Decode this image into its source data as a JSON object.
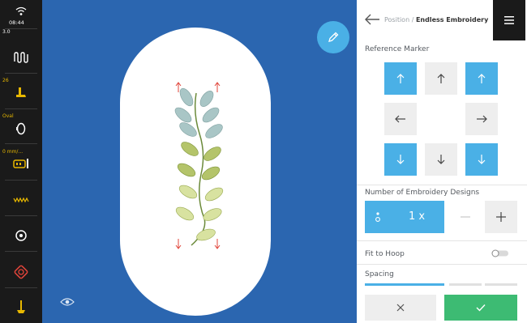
{
  "status_bar": {
    "time": "08:44",
    "stitch_length": "3.0",
    "presser_foot": "26",
    "hoop": "Oval",
    "speed": "0 mm/..."
  },
  "canvas": {
    "background_color": "#2b66b0",
    "hoop_color": "#ffffff",
    "edit_icon": "pencil-icon",
    "view_icon": "eye-icon"
  },
  "panel": {
    "breadcrumb_parent": "Position /",
    "breadcrumb_current": "Endless Embroidery",
    "reference_marker_label": "Reference Marker",
    "number_label": "Number of Embroidery Designs",
    "count_value": "1 x",
    "fit_to_hoop_label": "Fit to Hoop",
    "spacing_label": "Spacing",
    "accent_color": "#4ab0e6",
    "confirm_color": "#3dbb73"
  }
}
